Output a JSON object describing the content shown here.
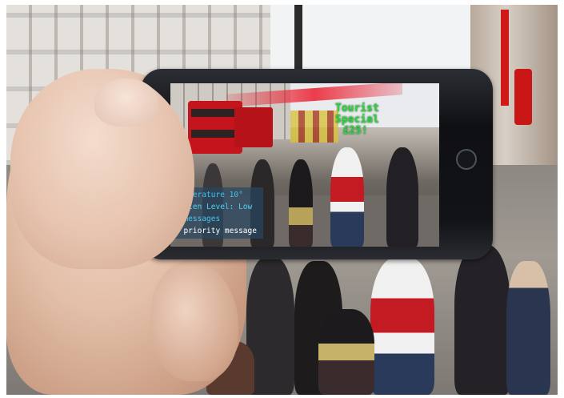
{
  "scene": {
    "description_tags": [
      "hand-icon",
      "phone-icon"
    ]
  },
  "ar_overlay": {
    "banner_text": "",
    "offer": {
      "line1": "Tourist",
      "line2": "Special",
      "line3": "£25!"
    },
    "info_lines": [
      "Temperature 10°",
      "Pollen Level: Low",
      "3 messages",
      "1 priority message"
    ],
    "badge_text": ""
  },
  "colors": {
    "offer_green": "#2cd53e",
    "info_blue": "#43c1ef",
    "brand_red": "#e0202c"
  }
}
